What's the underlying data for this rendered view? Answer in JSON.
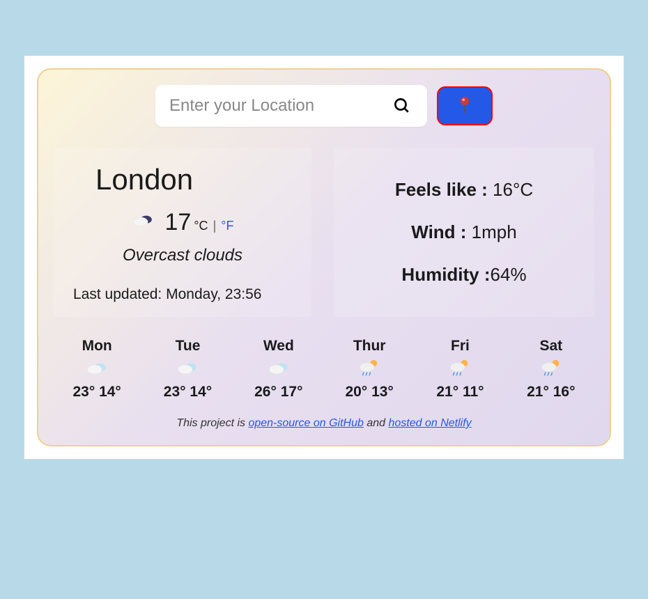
{
  "search": {
    "placeholder": "Enter your Location"
  },
  "current": {
    "city": "London",
    "temp": "17",
    "unit_c": "°C",
    "unit_sep": "|",
    "unit_f": "°F",
    "conditions": "Overcast clouds",
    "last_updated_label": "Last updated: ",
    "last_updated_value": "Monday, 23:56"
  },
  "metrics": {
    "feels_label": "Feels like : ",
    "feels_value": "16°C",
    "wind_label": "Wind : ",
    "wind_value": "1mph",
    "humidity_label": "Humidity :",
    "humidity_value": "64%"
  },
  "forecast": [
    {
      "day": "Mon",
      "hi": "23°",
      "lo": "14°",
      "icon": "cloud"
    },
    {
      "day": "Tue",
      "hi": "23°",
      "lo": "14°",
      "icon": "cloud"
    },
    {
      "day": "Wed",
      "hi": "26°",
      "lo": "17°",
      "icon": "cloud"
    },
    {
      "day": "Thur",
      "hi": "20°",
      "lo": "13°",
      "icon": "sunrain"
    },
    {
      "day": "Fri",
      "hi": "21°",
      "lo": "11°",
      "icon": "sunrain"
    },
    {
      "day": "Sat",
      "hi": "21°",
      "lo": "16°",
      "icon": "sunrain"
    }
  ],
  "footer": {
    "prefix": "This project is ",
    "link1": "open-source on GitHub",
    "mid": " and ",
    "link2": "hosted on Netlify"
  }
}
